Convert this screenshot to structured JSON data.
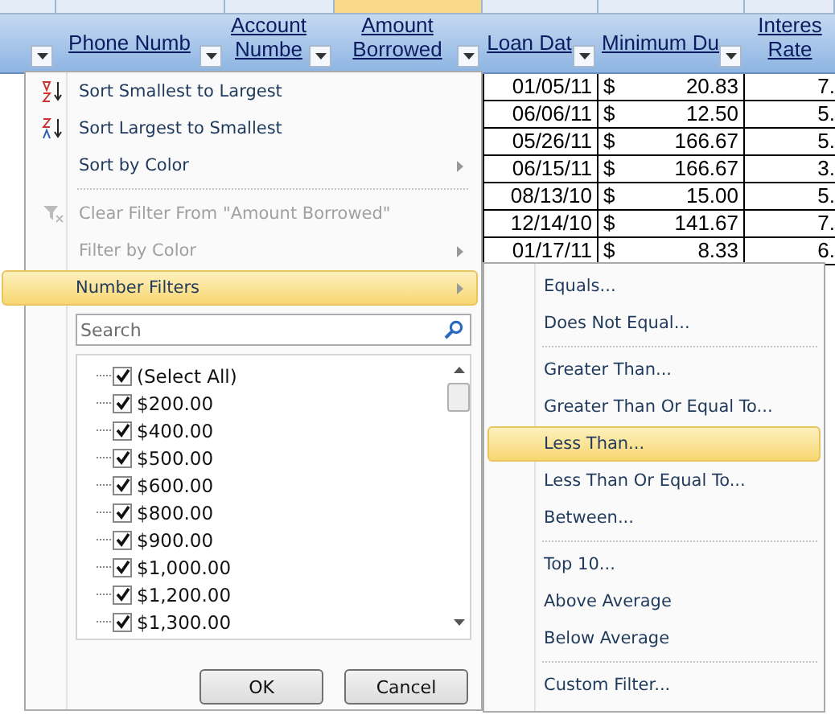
{
  "sheet": {
    "headers": [
      {
        "lines": [
          "Phone Numb"
        ]
      },
      {
        "lines": [
          "Account",
          "Numbe"
        ]
      },
      {
        "lines": [
          "Amount",
          "Borrowed"
        ]
      },
      {
        "lines": [
          "Loan Dat"
        ]
      },
      {
        "lines": [
          "Minimum Du"
        ]
      },
      {
        "lines": [
          "Interes",
          "Rate"
        ]
      }
    ],
    "rows": [
      {
        "date": "01/05/11",
        "currency": "$",
        "amount": "20.83",
        "rate": "7."
      },
      {
        "date": "06/06/11",
        "currency": "$",
        "amount": "12.50",
        "rate": "5."
      },
      {
        "date": "05/26/11",
        "currency": "$",
        "amount": "166.67",
        "rate": "5."
      },
      {
        "date": "06/15/11",
        "currency": "$",
        "amount": "166.67",
        "rate": "3."
      },
      {
        "date": "08/13/10",
        "currency": "$",
        "amount": "15.00",
        "rate": "5."
      },
      {
        "date": "12/14/10",
        "currency": "$",
        "amount": "141.67",
        "rate": "7."
      },
      {
        "date": "01/17/11",
        "currency": "$",
        "amount": "8.33",
        "rate": "6."
      }
    ]
  },
  "filter_menu": {
    "items": [
      {
        "kind": "sort-ascending",
        "label": "Sort Smallest to Largest",
        "disabled": false,
        "selected": false,
        "submenu": false
      },
      {
        "kind": "sort-descending",
        "label": "Sort Largest to Smallest",
        "disabled": false,
        "selected": false,
        "submenu": false
      },
      {
        "kind": "item",
        "label": "Sort by Color",
        "disabled": false,
        "selected": false,
        "submenu": true
      },
      {
        "kind": "separator"
      },
      {
        "kind": "clear-filter",
        "label": "Clear Filter From \"Amount Borrowed\"",
        "disabled": true,
        "selected": false,
        "submenu": false
      },
      {
        "kind": "item",
        "label": "Filter by Color",
        "disabled": true,
        "selected": false,
        "submenu": true
      },
      {
        "kind": "item",
        "label": "Number Filters",
        "disabled": false,
        "selected": true,
        "submenu": true
      }
    ],
    "search": {
      "placeholder": "Search"
    },
    "values": [
      {
        "label": "(Select All)",
        "checked": true
      },
      {
        "label": "$200.00",
        "checked": true
      },
      {
        "label": "$400.00",
        "checked": true
      },
      {
        "label": "$500.00",
        "checked": true
      },
      {
        "label": "$600.00",
        "checked": true
      },
      {
        "label": "$800.00",
        "checked": true
      },
      {
        "label": "$900.00",
        "checked": true
      },
      {
        "label": "$1,000.00",
        "checked": true
      },
      {
        "label": "$1,200.00",
        "checked": true
      },
      {
        "label": "$1,300.00",
        "checked": true
      }
    ],
    "buttons": [
      "OK",
      "Cancel"
    ]
  },
  "number_filters": [
    {
      "kind": "item",
      "label": "Equals...",
      "selected": false
    },
    {
      "kind": "item",
      "label": "Does Not Equal...",
      "selected": false
    },
    {
      "kind": "separator"
    },
    {
      "kind": "item",
      "label": "Greater Than...",
      "selected": false
    },
    {
      "kind": "item",
      "label": "Greater Than Or Equal To...",
      "selected": false
    },
    {
      "kind": "item",
      "label": "Less Than...",
      "selected": true
    },
    {
      "kind": "item",
      "label": "Less Than Or Equal To...",
      "selected": false
    },
    {
      "kind": "item",
      "label": "Between...",
      "selected": false
    },
    {
      "kind": "separator"
    },
    {
      "kind": "item",
      "label": "Top 10...",
      "selected": false
    },
    {
      "kind": "item",
      "label": "Above Average",
      "selected": false
    },
    {
      "kind": "item",
      "label": "Below Average",
      "selected": false
    },
    {
      "kind": "separator"
    },
    {
      "kind": "item",
      "label": "Custom Filter...",
      "selected": false
    }
  ]
}
